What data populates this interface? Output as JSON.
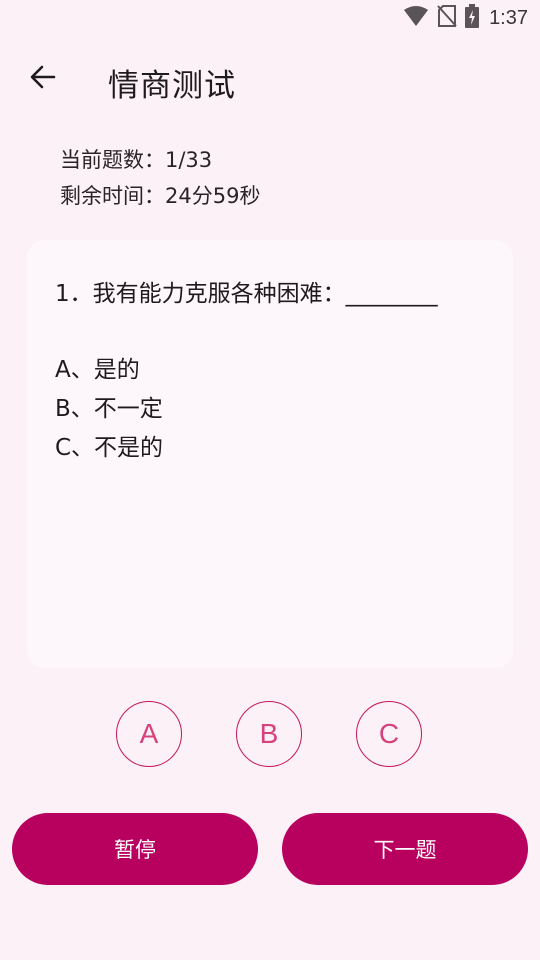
{
  "status_bar": {
    "time": "1:37",
    "icons": [
      "wifi-icon",
      "no-sim-icon",
      "battery-charging-icon"
    ]
  },
  "toolbar": {
    "back_icon": "arrow-left-icon",
    "title": "情商测试"
  },
  "info": {
    "current_question": "当前题数：1/33",
    "remaining_time": "剩余时间：24分59秒"
  },
  "question": {
    "text": "1．我有能力克服各种困难：________",
    "options": [
      "A、是的",
      "B、不一定",
      "C、不是的"
    ]
  },
  "choices": [
    "A",
    "B",
    "C"
  ],
  "actions": {
    "pause_label": "暂停",
    "next_label": "下一题"
  },
  "colors": {
    "background": "#fdf1f8",
    "card": "#fdf7fb",
    "accent": "#b8005e",
    "choice_text": "#d6427c"
  }
}
